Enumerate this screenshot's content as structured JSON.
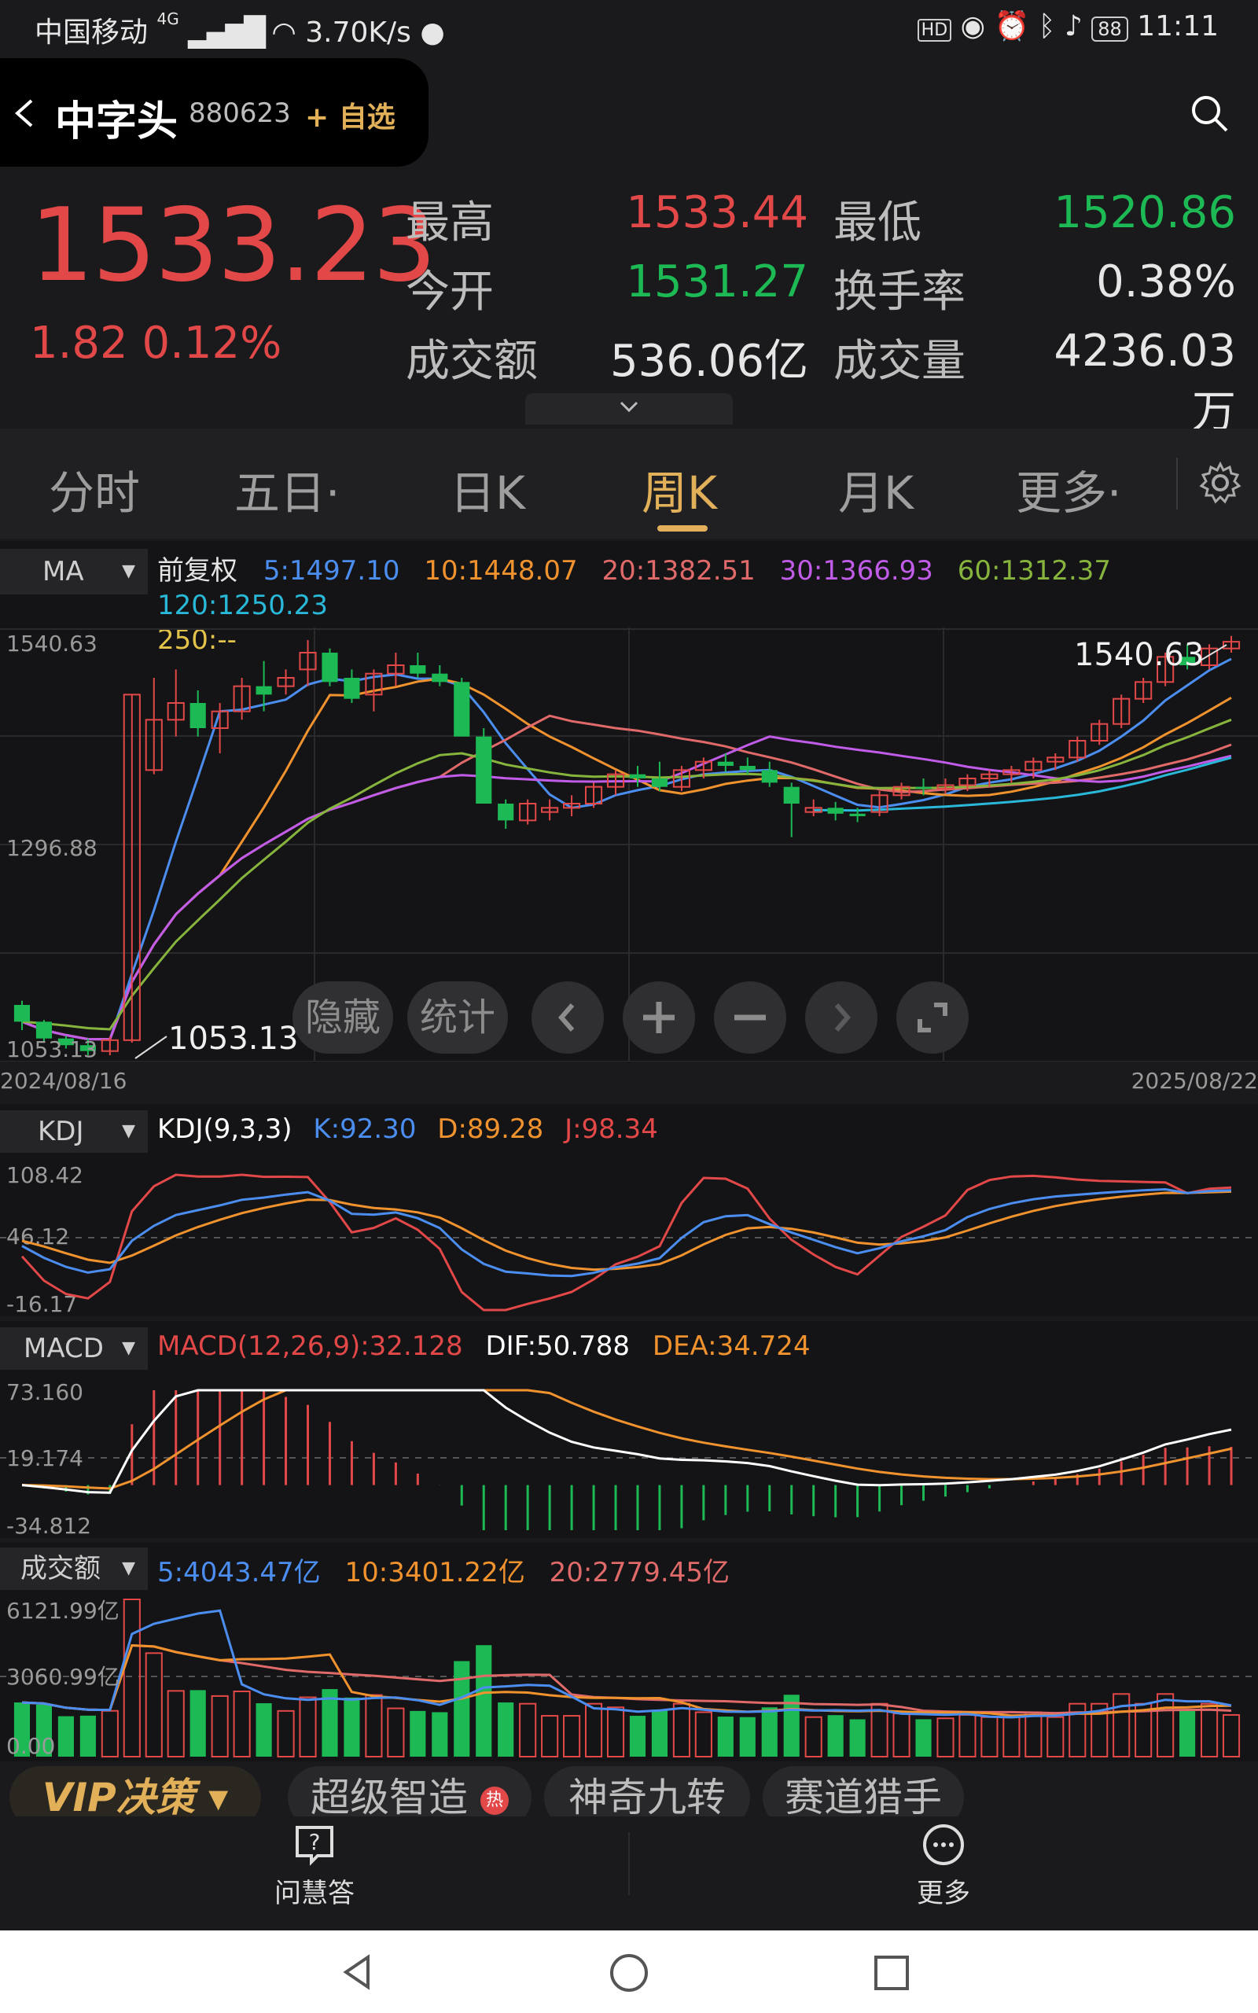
{
  "status_bar": {
    "carrier": "中国移动",
    "network": "4G",
    "speed": "3.70K/s",
    "battery": "88",
    "time": "11:11"
  },
  "header": {
    "name": "中字头",
    "code": "880623",
    "watch_label": "+ 自选"
  },
  "quote": {
    "price": "1533.23",
    "change": "1.82 0.12%",
    "items": [
      {
        "label": "最高",
        "value": "1533.44",
        "color": "#e24848"
      },
      {
        "label": "最低",
        "value": "1520.86",
        "color": "#1db954"
      },
      {
        "label": "今开",
        "value": "1531.27",
        "color": "#1db954"
      },
      {
        "label": "换手率",
        "value": "0.38%",
        "color": "#e6e6e6"
      },
      {
        "label": "成交额",
        "value": "536.06亿",
        "color": "#e6e6e6"
      },
      {
        "label": "成交量",
        "value": "4236.03万",
        "color": "#e6e6e6"
      }
    ]
  },
  "tabs": [
    "分时",
    "五日·",
    "日K",
    "周K",
    "月K",
    "更多·"
  ],
  "active_tab": "周K",
  "ma_panel": {
    "selector": "MA",
    "adjust": "前复权",
    "ma": [
      {
        "label": "5:1497.10",
        "color": "#4b8ef0"
      },
      {
        "label": "10:1448.07",
        "color": "#f0922e"
      },
      {
        "label": "20:1382.51",
        "color": "#e06a6a"
      },
      {
        "label": "30:1366.93",
        "color": "#c05ce8"
      },
      {
        "label": "60:1312.37",
        "color": "#86b43d"
      },
      {
        "label": "120:1250.23",
        "color": "#29b8d8"
      },
      {
        "label": "250:--",
        "color": "#e3c34a"
      }
    ],
    "y_max": "1540.63",
    "y_mid": "1296.88",
    "y_min": "1053.13",
    "high_marker": "1540.63",
    "low_marker": "1053.13",
    "date_start": "2024/08/16",
    "date_end": "2025/08/22"
  },
  "overlay": {
    "hide": "隐藏",
    "stats": "统计"
  },
  "kdj_panel": {
    "selector": "KDJ",
    "title": "KDJ(9,3,3)",
    "k": "K:92.30",
    "d": "D:89.28",
    "j": "J:98.34",
    "y_max": "108.42",
    "y_mid": "46.12",
    "y_min": "-16.17"
  },
  "macd_panel": {
    "selector": "MACD",
    "title": "MACD(12,26,9):32.128",
    "dif": "DIF:50.788",
    "dea": "DEA:34.724",
    "y_max": "73.160",
    "y_mid": "19.174",
    "y_min": "-34.812"
  },
  "amount_panel": {
    "selector": "成交额",
    "ma5": "5:4043.47亿",
    "ma10": "10:3401.22亿",
    "ma20": "20:2779.45亿",
    "y_max": "6121.99亿",
    "y_mid": "3060.99亿",
    "y_min": "0.00"
  },
  "features": [
    "VIP决策 ▾",
    "超级智造",
    "神奇九转",
    "赛道猎手"
  ],
  "feature_hot": "热",
  "bottom_nav": [
    {
      "label": "问慧答",
      "icon": "question-icon"
    },
    {
      "label": "更多",
      "icon": "more-icon"
    }
  ],
  "colors": {
    "up": "#e24848",
    "down": "#1db954",
    "accent": "#e3b05a"
  },
  "chart_data": [
    {
      "type": "candlestick",
      "title": "周K",
      "x_range": [
        "2024/08/16",
        "2025/08/22"
      ],
      "ylim": [
        1053.13,
        1540.63
      ],
      "ohlc": [
        [
          1100,
          1105,
          1070,
          1080
        ],
        [
          1080,
          1082,
          1055,
          1060
        ],
        [
          1060,
          1063,
          1048,
          1052
        ],
        [
          1052,
          1060,
          1040,
          1045
        ],
        [
          1045,
          1062,
          1040,
          1058
        ],
        [
          1058,
          1470,
          1055,
          1470
        ],
        [
          1380,
          1490,
          1375,
          1440
        ],
        [
          1440,
          1500,
          1420,
          1460
        ],
        [
          1460,
          1475,
          1420,
          1430
        ],
        [
          1430,
          1460,
          1400,
          1450
        ],
        [
          1450,
          1490,
          1440,
          1480
        ],
        [
          1480,
          1510,
          1450,
          1470
        ],
        [
          1480,
          1500,
          1470,
          1490
        ],
        [
          1500,
          1535,
          1480,
          1520
        ],
        [
          1520,
          1525,
          1480,
          1485
        ],
        [
          1490,
          1500,
          1460,
          1465
        ],
        [
          1470,
          1500,
          1450,
          1495
        ],
        [
          1495,
          1520,
          1480,
          1505
        ],
        [
          1505,
          1520,
          1490,
          1495
        ],
        [
          1495,
          1505,
          1480,
          1485
        ],
        [
          1485,
          1490,
          1420,
          1420
        ],
        [
          1420,
          1430,
          1340,
          1340
        ],
        [
          1340,
          1345,
          1310,
          1320
        ],
        [
          1320,
          1345,
          1315,
          1340
        ],
        [
          1330,
          1345,
          1320,
          1335
        ],
        [
          1335,
          1350,
          1325,
          1340
        ],
        [
          1340,
          1365,
          1335,
          1360
        ],
        [
          1360,
          1380,
          1350,
          1375
        ],
        [
          1375,
          1385,
          1360,
          1370
        ],
        [
          1370,
          1390,
          1355,
          1360
        ],
        [
          1360,
          1385,
          1355,
          1380
        ],
        [
          1380,
          1395,
          1370,
          1390
        ],
        [
          1390,
          1400,
          1378,
          1385
        ],
        [
          1385,
          1395,
          1375,
          1380
        ],
        [
          1380,
          1390,
          1360,
          1365
        ],
        [
          1360,
          1365,
          1300,
          1340
        ],
        [
          1330,
          1345,
          1325,
          1335
        ],
        [
          1335,
          1342,
          1320,
          1328
        ],
        [
          1328,
          1335,
          1318,
          1325
        ],
        [
          1330,
          1355,
          1325,
          1350
        ],
        [
          1350,
          1365,
          1345,
          1360
        ],
        [
          1360,
          1370,
          1350,
          1358
        ],
        [
          1358,
          1370,
          1352,
          1362
        ],
        [
          1362,
          1375,
          1355,
          1370
        ],
        [
          1370,
          1380,
          1360,
          1375
        ],
        [
          1375,
          1385,
          1365,
          1380
        ],
        [
          1380,
          1395,
          1370,
          1390
        ],
        [
          1390,
          1400,
          1380,
          1395
        ],
        [
          1395,
          1420,
          1390,
          1415
        ],
        [
          1415,
          1440,
          1410,
          1435
        ],
        [
          1435,
          1470,
          1430,
          1465
        ],
        [
          1465,
          1490,
          1460,
          1485
        ],
        [
          1485,
          1520,
          1480,
          1515
        ],
        [
          1515,
          1530,
          1500,
          1505
        ],
        [
          1505,
          1530,
          1500,
          1525
        ],
        [
          1525,
          1540,
          1520,
          1533
        ]
      ]
    },
    {
      "type": "line",
      "title": "KDJ(9,3,3)",
      "series": [
        {
          "name": "K",
          "last": 92.3
        },
        {
          "name": "D",
          "last": 89.28
        },
        {
          "name": "J",
          "last": 98.34
        }
      ],
      "ylim": [
        -16.17,
        108.42
      ]
    },
    {
      "type": "bar",
      "title": "MACD(12,26,9)",
      "series": [
        {
          "name": "MACD",
          "last": 32.128
        },
        {
          "name": "DIF",
          "last": 50.788
        },
        {
          "name": "DEA",
          "last": 34.724
        }
      ],
      "ylim": [
        -34.812,
        73.16
      ]
    },
    {
      "type": "bar",
      "title": "成交额",
      "series": [
        {
          "name": "5",
          "last": 4043.47
        },
        {
          "name": "10",
          "last": 3401.22
        },
        {
          "name": "20",
          "last": 2779.45
        }
      ],
      "ylim": [
        0,
        6121.99
      ]
    }
  ]
}
